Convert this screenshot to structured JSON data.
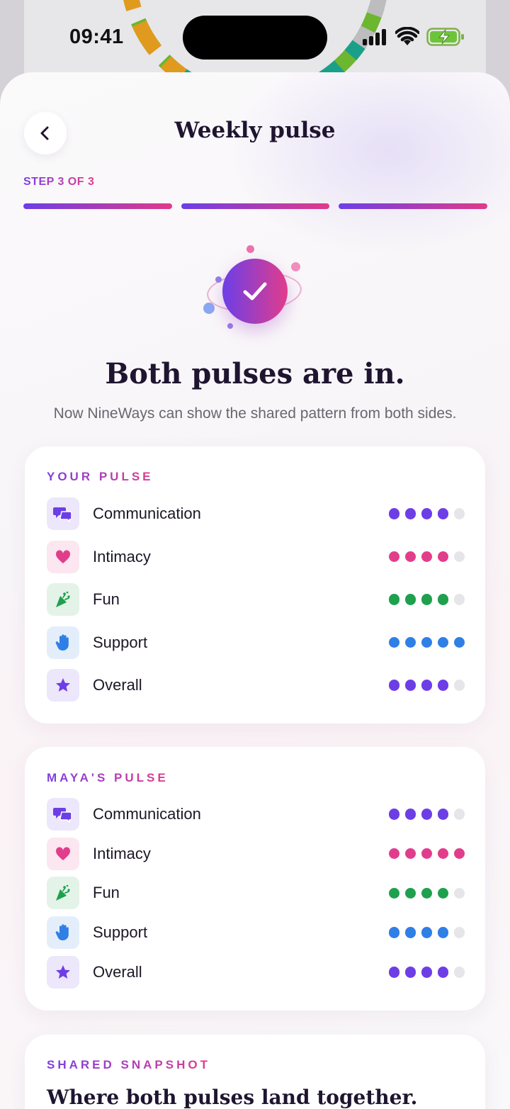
{
  "status_bar": {
    "time": "09:41"
  },
  "header": {
    "title": "Weekly pulse",
    "step": "STEP 3 OF 3",
    "steps_total": 3,
    "steps_done": 3
  },
  "hero": {
    "headline": "Both pulses are in.",
    "subtext": "Now NineWays can show the shared pattern from both sides."
  },
  "colors": {
    "communication": "#6d3ee6",
    "intimacy": "#e23d8c",
    "fun": "#1fa04e",
    "support": "#2f7fe6",
    "overall": "#6d3ee6",
    "empty": "#e6e6e8"
  },
  "your_pulse": {
    "label": "YOUR PULSE",
    "items": [
      {
        "name": "Communication",
        "icon": "speech-bubbles-icon",
        "score": 4,
        "max": 5
      },
      {
        "name": "Intimacy",
        "icon": "heart-icon",
        "score": 4,
        "max": 5
      },
      {
        "name": "Fun",
        "icon": "party-popper-icon",
        "score": 4,
        "max": 5
      },
      {
        "name": "Support",
        "icon": "raised-hand-icon",
        "score": 5,
        "max": 5
      },
      {
        "name": "Overall",
        "icon": "star-icon",
        "score": 4,
        "max": 5
      }
    ]
  },
  "partner_pulse": {
    "label": "MAYA'S PULSE",
    "items": [
      {
        "name": "Communication",
        "icon": "speech-bubbles-icon",
        "score": 4,
        "max": 5
      },
      {
        "name": "Intimacy",
        "icon": "heart-icon",
        "score": 5,
        "max": 5
      },
      {
        "name": "Fun",
        "icon": "party-popper-icon",
        "score": 4,
        "max": 5
      },
      {
        "name": "Support",
        "icon": "raised-hand-icon",
        "score": 4,
        "max": 5
      },
      {
        "name": "Overall",
        "icon": "star-icon",
        "score": 4,
        "max": 5
      }
    ]
  },
  "shared_snapshot": {
    "label": "SHARED SNAPSHOT",
    "title": "Where both pulses land together."
  }
}
